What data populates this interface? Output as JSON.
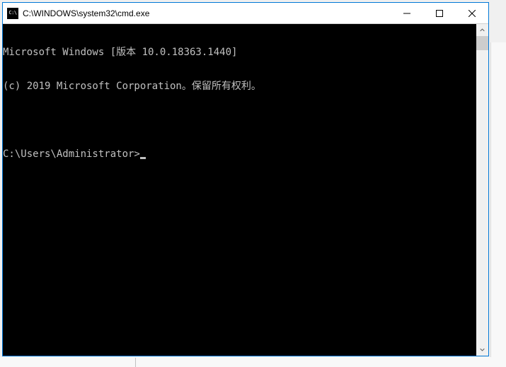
{
  "window": {
    "title": "C:\\WINDOWS\\system32\\cmd.exe",
    "icon_text": "C:\\"
  },
  "console": {
    "line1": "Microsoft Windows [版本 10.0.18363.1440]",
    "line2": "(c) 2019 Microsoft Corporation。保留所有权利。",
    "blank": "",
    "prompt": "C:\\Users\\Administrator>"
  }
}
